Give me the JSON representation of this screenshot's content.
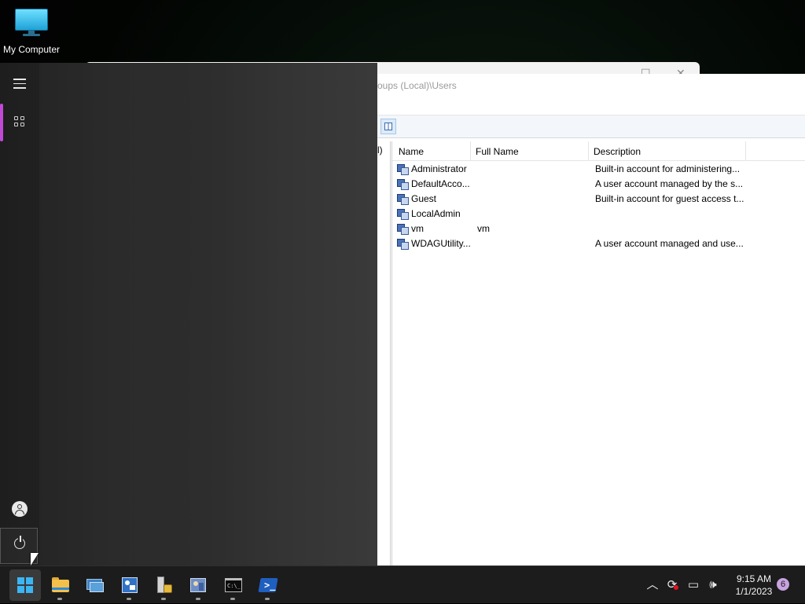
{
  "desktop": {
    "icons": [
      {
        "label": "My Computer",
        "icon": "monitor-icon"
      }
    ]
  },
  "mmc": {
    "path_fragment": "oups (Local)\\Users",
    "tree_fragment": "l)",
    "columns": [
      "Name",
      "Full Name",
      "Description"
    ],
    "rows": [
      {
        "name": "Administrator",
        "full_name": "",
        "description": "Built-in account for administering..."
      },
      {
        "name": "DefaultAcco...",
        "full_name": "",
        "description": "A user account managed by the s..."
      },
      {
        "name": "Guest",
        "full_name": "",
        "description": "Built-in account for guest access t..."
      },
      {
        "name": "LocalAdmin",
        "full_name": "",
        "description": ""
      },
      {
        "name": "vm",
        "full_name": "vm",
        "description": ""
      },
      {
        "name": "WDAGUtility...",
        "full_name": "",
        "description": "A user account managed and use..."
      }
    ]
  },
  "start_menu": {
    "rail": [
      "hamburger-menu-icon",
      "all-apps-icon",
      "user-icon",
      "power-icon"
    ]
  },
  "taskbar": {
    "items": [
      "start-button",
      "file-explorer",
      "remote-desktop",
      "computer-management",
      "server-manager",
      "local-users-and-groups",
      "command-prompt",
      "powershell"
    ],
    "tray": [
      "chevron-up-icon",
      "sync-icon",
      "network-icon",
      "volume-icon"
    ],
    "time": "9:15 AM",
    "date": "1/1/2023",
    "notification_count": "6",
    "accent_color": "#3cb5f4"
  }
}
